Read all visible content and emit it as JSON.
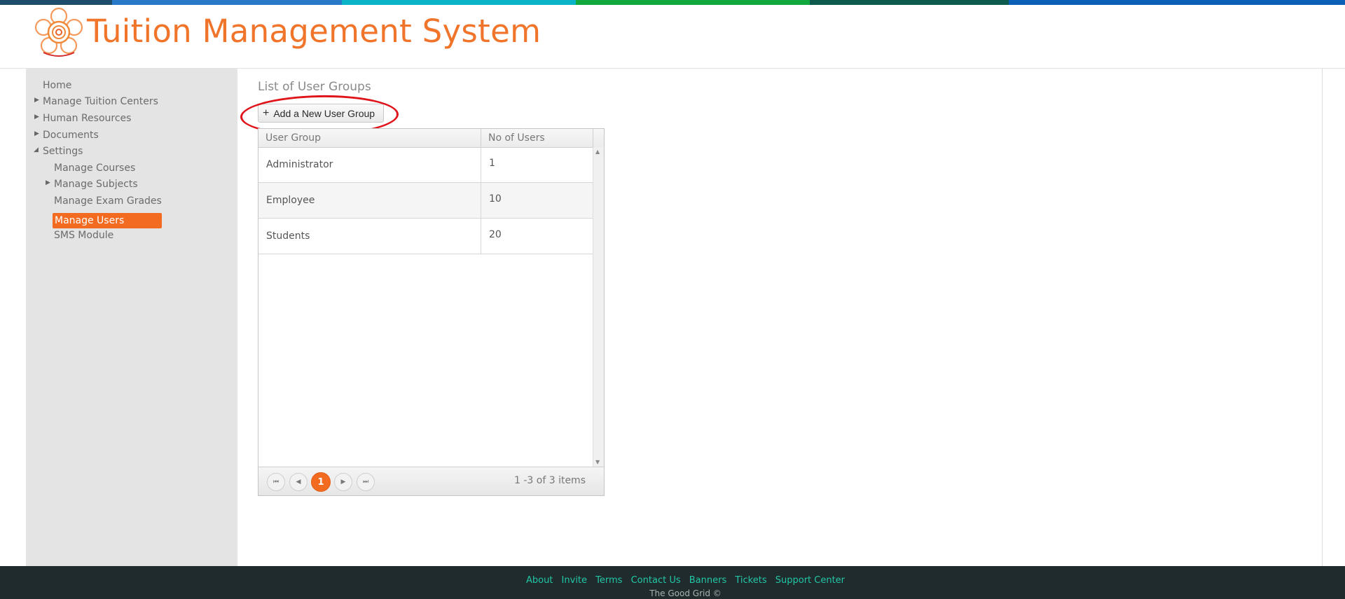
{
  "brand": {
    "title": "Tuition Management System",
    "logo_icon": "flower-logo-icon",
    "accent_color": "#f0742a",
    "stripe_colors": [
      "#1e4d6b",
      "#2a78c8",
      "#0bb3c9",
      "#11a83e",
      "#0e5a4e",
      "#0b5fb6"
    ]
  },
  "sidebar": {
    "items": [
      {
        "label": "Home"
      },
      {
        "label": "Manage Tuition Centers"
      },
      {
        "label": "Human Resources"
      },
      {
        "label": "Documents"
      },
      {
        "label": "Settings"
      },
      {
        "label": "Manage Courses"
      },
      {
        "label": "Manage Subjects"
      },
      {
        "label": "Manage Exam Grades"
      },
      {
        "label": "Manage Users"
      },
      {
        "label": "SMS Module"
      }
    ],
    "active_item": "Manage Users"
  },
  "main": {
    "section_title": "List of User Groups",
    "add_button_label": "Add a New User Group",
    "grid": {
      "columns": [
        "User Group",
        "No of Users"
      ],
      "rows": [
        {
          "group": "Administrator",
          "users": "1"
        },
        {
          "group": "Employee",
          "users": "10"
        },
        {
          "group": "Students",
          "users": "20"
        }
      ],
      "pager": {
        "current_page": "1",
        "info": "1 -3 of 3 items"
      }
    }
  },
  "footer": {
    "links": [
      "About",
      "Invite",
      "Terms",
      "Contact Us",
      "Banners",
      "Tickets",
      "Support Center"
    ],
    "copyright": "The Good Grid ©"
  }
}
